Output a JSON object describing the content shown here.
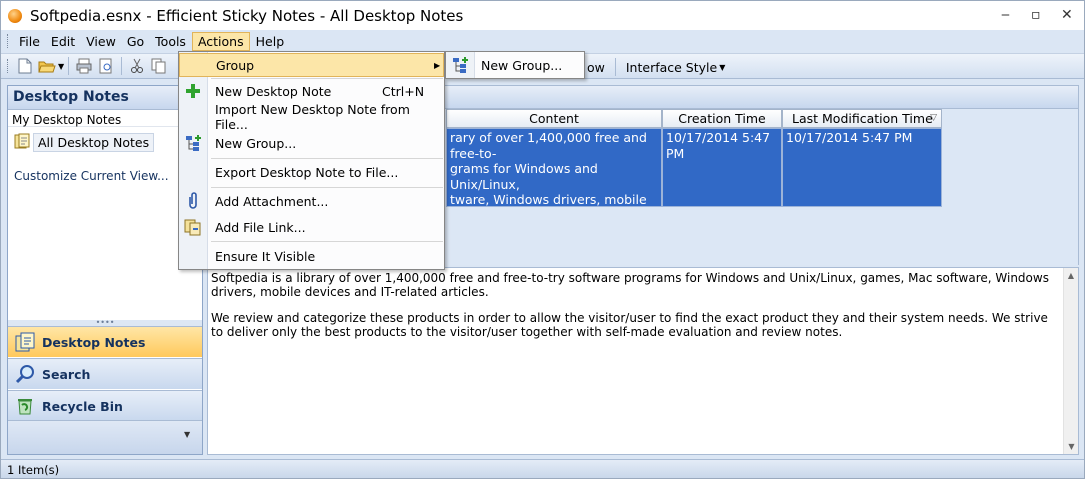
{
  "window": {
    "title": "Softpedia.esnx - Efficient Sticky Notes - All Desktop Notes",
    "controls": [
      "‒",
      "▫",
      "✕"
    ]
  },
  "menubar": {
    "items": [
      {
        "label": "File"
      },
      {
        "label": "Edit"
      },
      {
        "label": "View"
      },
      {
        "label": "Go"
      },
      {
        "label": "Tools"
      },
      {
        "label": "Actions"
      },
      {
        "label": "Help"
      }
    ]
  },
  "toolbar": {
    "window_label": "ow",
    "interface_style_label": "Interface Style"
  },
  "left_pane": {
    "header": "Desktop Notes",
    "subheader": "My Desktop Notes",
    "tree_item": "All Desktop Notes",
    "customize_link": "Customize Current View...",
    "nav_buttons": [
      {
        "label": "Desktop Notes",
        "icon": "desktop-notes-icon"
      },
      {
        "label": "Search",
        "icon": "search-icon"
      },
      {
        "label": "Recycle Bin",
        "icon": "recycle-bin-icon"
      }
    ]
  },
  "grid": {
    "columns": [
      "Content",
      "Creation Time",
      "Last Modification Time"
    ],
    "row": {
      "content": "rary of over 1,400,000 free and free-to-\ngrams for Windows and Unix/Linux,\ntware, Windows drivers, mobile devices\nticles.",
      "creation_time": "10/17/2014 5:47 PM",
      "modification_time": "10/17/2014 5:47 PM"
    }
  },
  "preview": {
    "paragraphs": [
      "Softpedia is a library of over 1,400,000 free and free-to-try software programs for Windows and Unix/Linux, games, Mac software, Windows drivers, mobile devices and IT-related articles.",
      "We review and categorize these products in order to allow the visitor/user to find the exact product they and their system needs. We strive to deliver only the best products to the visitor/user together with self-made evaluation and review notes."
    ]
  },
  "statusbar": {
    "text": "1 Item(s)"
  },
  "actions_menu": {
    "items": [
      {
        "label": "Group",
        "has_submenu": true
      },
      {
        "label": "New Desktop Note",
        "shortcut": "Ctrl+N",
        "icon": "plus-icon"
      },
      {
        "label": "Import New Desktop Note from File..."
      },
      {
        "label": "New Group...",
        "icon": "new-group-icon"
      },
      {
        "label": "Export Desktop Note to File..."
      },
      {
        "label": "Add Attachment...",
        "icon": "paperclip-icon"
      },
      {
        "label": "Add File Link...",
        "icon": "file-link-icon"
      },
      {
        "label": "Ensure It Visible"
      }
    ],
    "submenu": {
      "label": "New Group..."
    }
  },
  "colors": {
    "selection": "#3169c6",
    "menu_highlight": "#fce6a8",
    "chrome": "#dbe6f4"
  }
}
